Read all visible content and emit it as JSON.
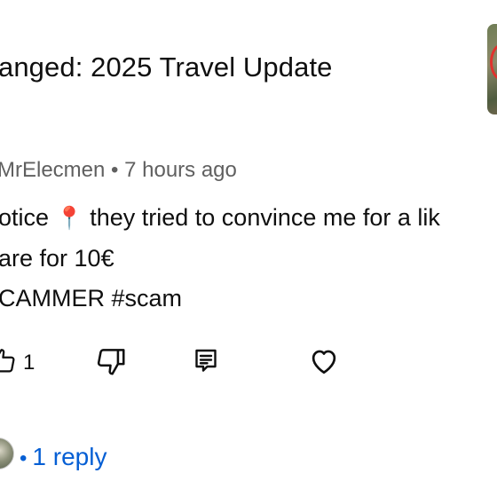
{
  "video": {
    "title": "anged: 2025 Travel Update"
  },
  "comment": {
    "author": "MrElecmen",
    "separator": "•",
    "time": "7 hours ago",
    "line1_start": "otice",
    "pin_glyph": "📍",
    "line1_rest": " they tried to convince me for a lik",
    "line2": "are for 10€",
    "line3": "CAMMER #scam",
    "like_count": "1"
  },
  "icons": {
    "like": "thumbs-up-icon",
    "dislike": "thumbs-down-icon",
    "reply": "reply-comment-icon",
    "heart": "heart-icon",
    "pin": "location-pin-icon"
  },
  "replies": {
    "dot": "•",
    "label": "1 reply"
  },
  "colors": {
    "text_primary": "#0f0f0f",
    "text_secondary": "#606060",
    "link_blue": "#065fd4",
    "pin_red": "#e4312b"
  }
}
